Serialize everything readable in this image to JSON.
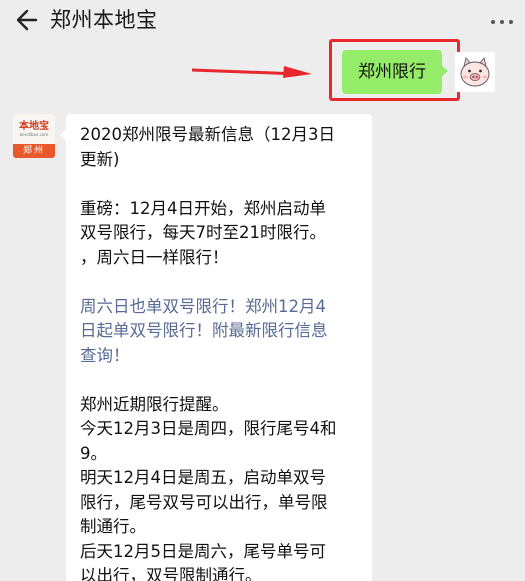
{
  "header": {
    "title": "郑州本地宝"
  },
  "outgoing": {
    "text": "郑州限行"
  },
  "bot": {
    "logo_name": "本地宝",
    "logo_url": "bendibao.com",
    "logo_city": "郑州"
  },
  "reply": {
    "p1": "2020郑州限号最新信息（12月3日\n更新)",
    "p2": "重磅：12月4日开始，郑州启动单\n双号限行，每天7时至21时限行。\n，周六日一样限行！",
    "link": "周六日也单双号限行！郑州12月4\n日起单双号限行！附最新限行信息\n查询！",
    "p3": "郑州近期限行提醒。",
    "p4": "今天12月3日是周四，限行尾号4和\n9。",
    "p5": "明天12月4日是周五，启动单双号\n限行，尾号双号可以出行，单号限\n制通行。",
    "p6": "后天12月5日是周六，尾号单号可\n以出行，双号限制通行。"
  },
  "colors": {
    "highlight_frame": "#e8282d",
    "outgoing_bubble": "#95ec69",
    "link": "#576b95",
    "logo_accent": "#e8582a"
  },
  "icons": {
    "back": "back-arrow-icon",
    "more": "more-dots-icon",
    "pointer": "red-arrow-icon",
    "user": "pig-avatar-icon"
  }
}
